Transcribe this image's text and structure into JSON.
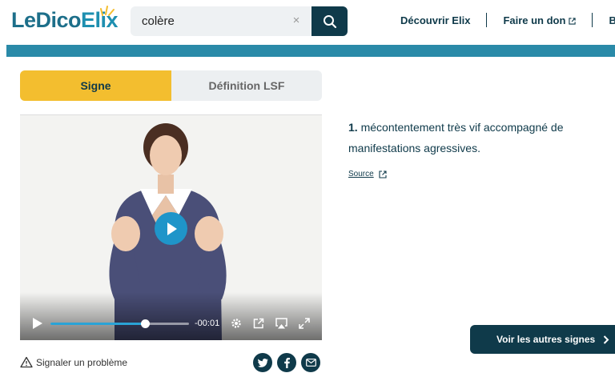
{
  "header": {
    "logo_part1": "LeDico",
    "logo_part2": "Elix",
    "search": {
      "value": "colère",
      "clear_glyph": "×"
    },
    "nav": {
      "discover": "Découvrir Elix",
      "donate": "Faire un don",
      "cut": "Bo"
    }
  },
  "tabs": {
    "sign": "Signe",
    "definition_lsf": "Définition LSF"
  },
  "video": {
    "time_remaining": "-00:01",
    "progress": 0.68
  },
  "report_problem": "Signaler un problème",
  "definition": {
    "number": "1.",
    "text": "mécontentement très vif accompagné de manifestations agressives.",
    "source_label": "Source"
  },
  "more_signs": "Voir les autres signes",
  "colors": {
    "navy": "#0f3a4a",
    "teal": "#2a8aa8",
    "yellow": "#f3be2f",
    "play_blue": "#1f95c9"
  },
  "icons": [
    "search-icon",
    "clear-icon",
    "external-link-icon",
    "play-icon",
    "settings-icon",
    "popout-icon",
    "airplay-icon",
    "fullscreen-icon",
    "warning-icon",
    "twitter-icon",
    "facebook-icon",
    "mail-icon",
    "chevron-right-icon"
  ]
}
